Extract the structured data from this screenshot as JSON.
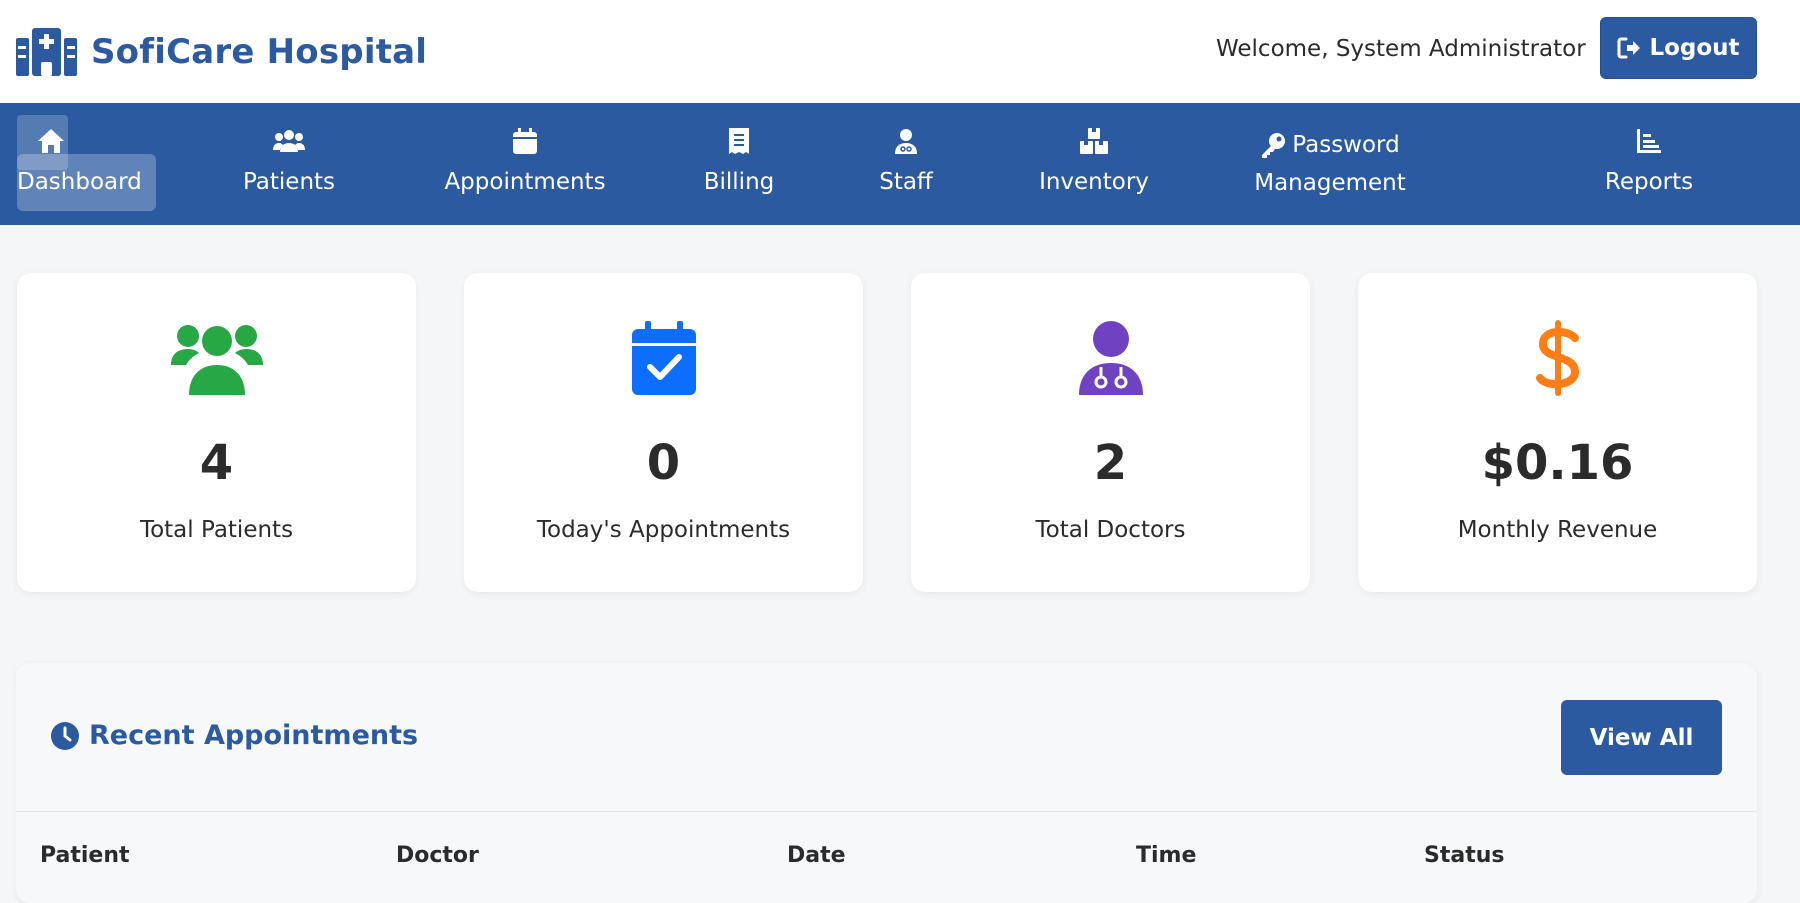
{
  "header": {
    "brand": "SofiCare Hospital",
    "brand_icon": "hospital-icon",
    "welcome": "Welcome, System Administrator",
    "logout_label": "Logout",
    "logout_icon": "sign-out-icon"
  },
  "nav": {
    "items": [
      {
        "label": "Dashboard",
        "icon": "home-icon",
        "active": true
      },
      {
        "label": "Patients",
        "icon": "users-icon"
      },
      {
        "label": "Appointments",
        "icon": "calendar-icon"
      },
      {
        "label": "Billing",
        "icon": "receipt-icon"
      },
      {
        "label": "Staff",
        "icon": "user-doctor-icon"
      },
      {
        "label": "Inventory",
        "icon": "boxes-icon"
      },
      {
        "label_line1": "Password",
        "label_line2": "Management",
        "icon": "key-icon"
      },
      {
        "label": "Reports",
        "icon": "chart-icon"
      }
    ]
  },
  "stats": [
    {
      "value": "4",
      "label": "Total Patients",
      "icon": "users-icon",
      "color": "#28a745"
    },
    {
      "value": "0",
      "label": "Today's Appointments",
      "icon": "calendar-check-icon",
      "color": "#0d6efd"
    },
    {
      "value": "2",
      "label": "Total Doctors",
      "icon": "user-doctor-icon",
      "color": "#6f42c1"
    },
    {
      "value": "$0.16",
      "label": "Monthly Revenue",
      "icon": "dollar-icon",
      "color": "#fd7e14"
    }
  ],
  "appointments": {
    "title": "Recent Appointments",
    "title_icon": "clock-icon",
    "view_all": "View All",
    "columns": [
      "Patient",
      "Doctor",
      "Date",
      "Time",
      "Status"
    ]
  },
  "colors": {
    "primary": "#2b5aa0",
    "background": "#f5f6f8"
  }
}
